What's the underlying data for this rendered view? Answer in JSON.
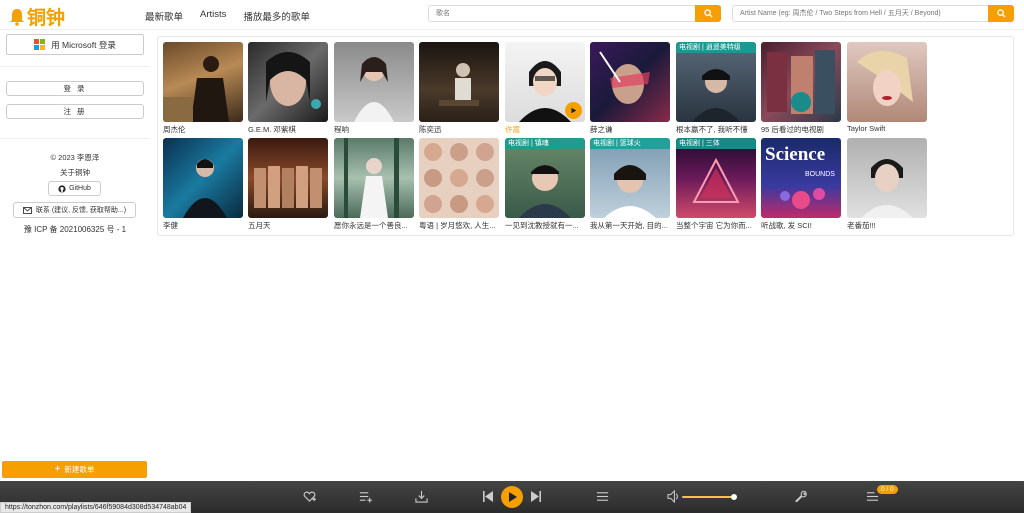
{
  "brand": {
    "name": "铜钟",
    "color": "#f5a000"
  },
  "nav": {
    "items": [
      "最新歌单",
      "Artists",
      "播放最多的歌单"
    ]
  },
  "search": {
    "placeholder": "歌名",
    "icon": "search-icon"
  },
  "artist_search": {
    "placeholder": "Artist Name (eg: 周杰伦 / Two Steps from Hell / 五月天 / Beyond)",
    "icon": "search-icon"
  },
  "sidebar": {
    "ms_login": "用 Microsoft 登录",
    "login": "登 录",
    "register": "注 册",
    "copyright": "© 2023 李恩泽",
    "about": "关于铜钟",
    "github": "GitHub",
    "contact": "联系 (建议, 反馈, 获取帮助...)",
    "icp": "豫 ICP 备 2021006325 号 - 1",
    "new_playlist": "新建歌单"
  },
  "playlists": [
    {
      "title": "周杰伦",
      "tag": ""
    },
    {
      "title": "G.E.M. 邓紫棋",
      "tag": ""
    },
    {
      "title": "程响",
      "tag": ""
    },
    {
      "title": "陈奕迅",
      "tag": ""
    },
    {
      "title": "许嵩",
      "tag": "",
      "highlighted": true
    },
    {
      "title": "薛之谦",
      "tag": ""
    },
    {
      "title": "根本赢不了, 我听不懂",
      "tag": "电视剧 | 逍遥美特级"
    },
    {
      "title": "95 后看过的电视剧",
      "tag": ""
    },
    {
      "title": "Taylor Swift",
      "tag": ""
    },
    {
      "title": "李健",
      "tag": ""
    },
    {
      "title": "五月天",
      "tag": ""
    },
    {
      "title": "愿你永远是一个善良...",
      "tag": ""
    },
    {
      "title": "粤语 | 岁月悠欢, 人生...",
      "tag": ""
    },
    {
      "title": "一见到沈教授就有一...",
      "tag": "电视剧 | 镇魂"
    },
    {
      "title": "我从第一天开始, 目的...",
      "tag": "电视剧 | 篮球火"
    },
    {
      "title": "当整个宇宙 它为你而...",
      "tag": "电视剧 | 三体"
    },
    {
      "title": "听战歌, 发 SCI!",
      "tag": ""
    },
    {
      "title": "老番茄!!!",
      "tag": ""
    }
  ],
  "player": {
    "queue_count": "0 / 0",
    "volume": 0.9
  },
  "status_url": "https://tonzhon.com/playlists/646f59084d308d534748ab04"
}
